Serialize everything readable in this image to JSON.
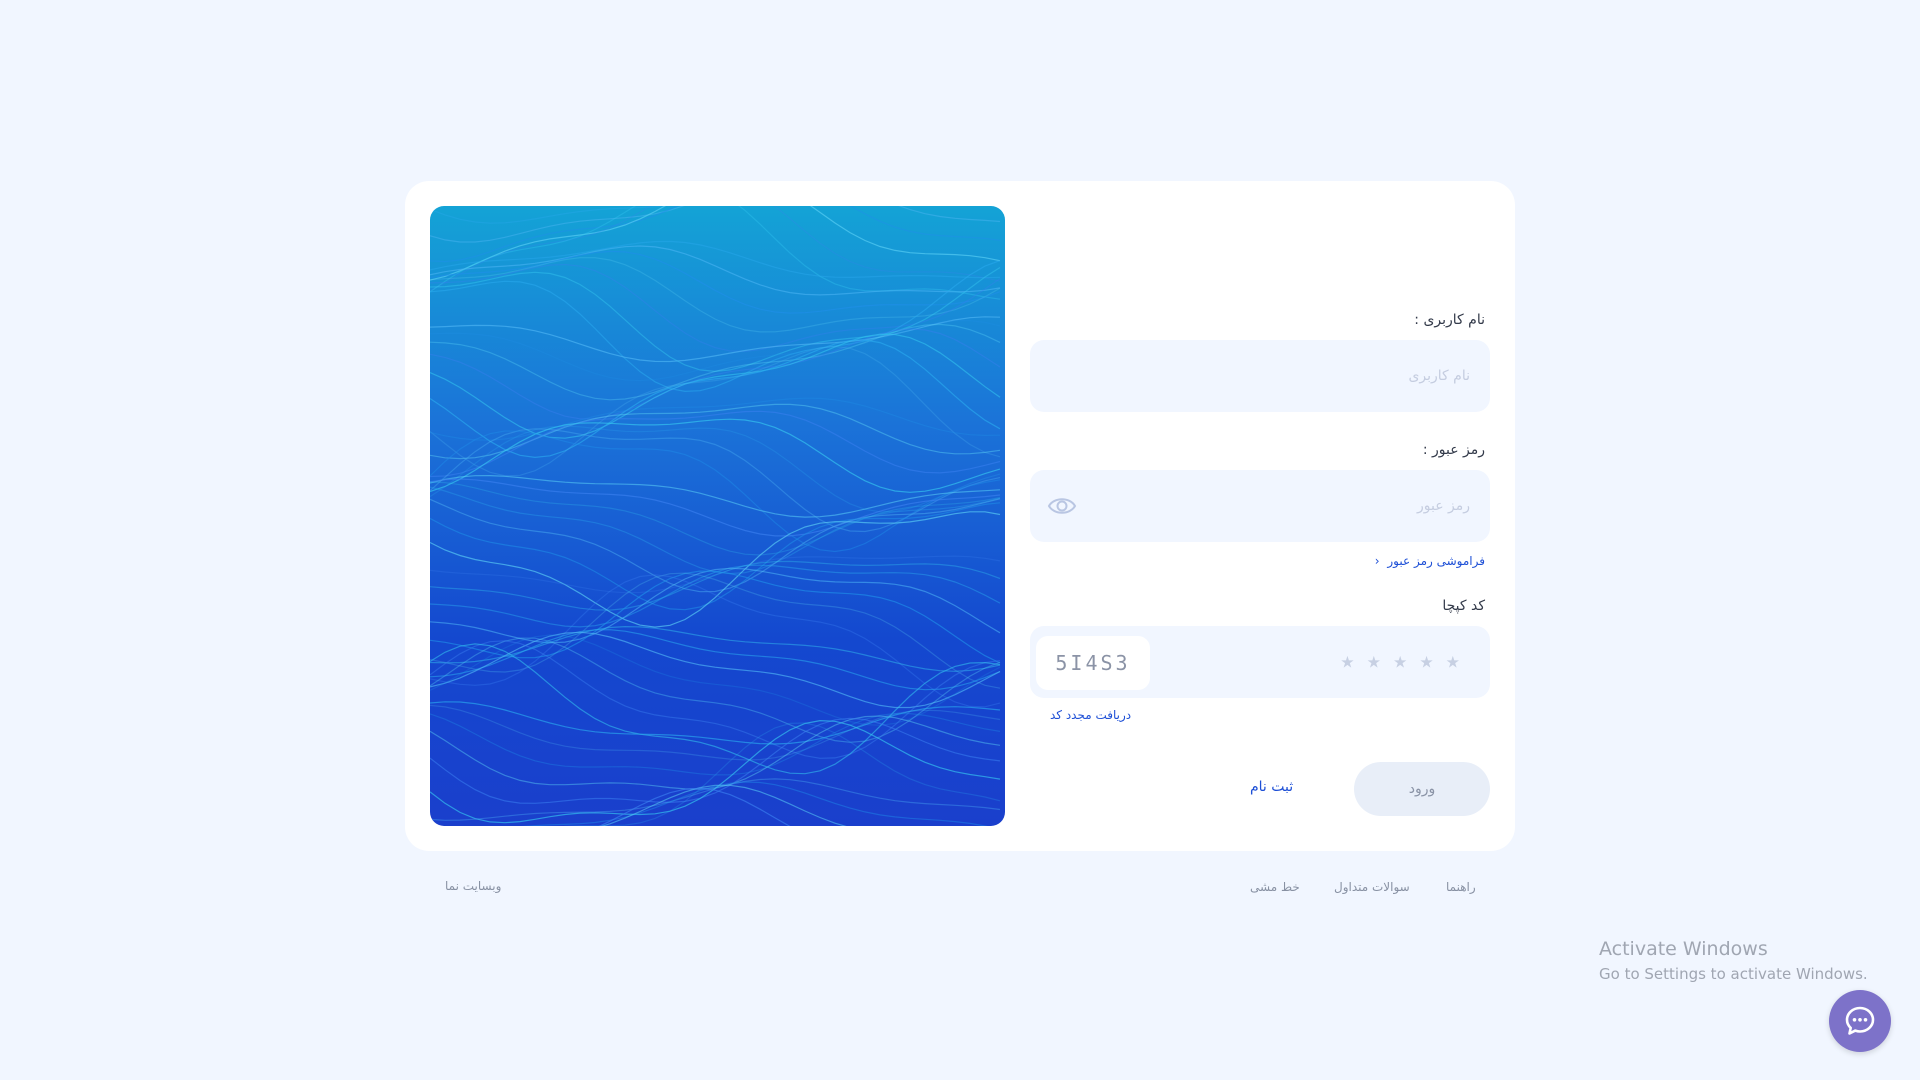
{
  "form": {
    "username_label": "نام کاربری :",
    "username_placeholder": "نام کاربری",
    "password_label": "رمز عبور :",
    "password_placeholder": "رمز عبور",
    "forgot_password": "فراموشی رمز عبور",
    "captcha_label": "کد کپچا",
    "captcha_code": "5I4S3",
    "captcha_placeholder_stars": [
      "★",
      "★",
      "★",
      "★",
      "★"
    ],
    "refresh_code": "دریافت مجدد کد",
    "login_button": "ورود",
    "register_link": "ثبت نام"
  },
  "footer": {
    "guide": "راهنما",
    "faq": "سوالات متداول",
    "policy": "خط مشی",
    "site": "وبسایت نما"
  },
  "watermark": {
    "title": "Activate Windows",
    "subtitle": "Go to Settings to activate Windows."
  },
  "icons": {
    "password_toggle": "eye-icon",
    "forgot_chevron": "chevron-left-icon",
    "chat": "chat-bubble-icon"
  },
  "colors": {
    "background": "#f1f6ff",
    "accent_link": "#1d4fd6",
    "field_bg": "#f1f6ff",
    "chat_button": "#7d72c9"
  }
}
